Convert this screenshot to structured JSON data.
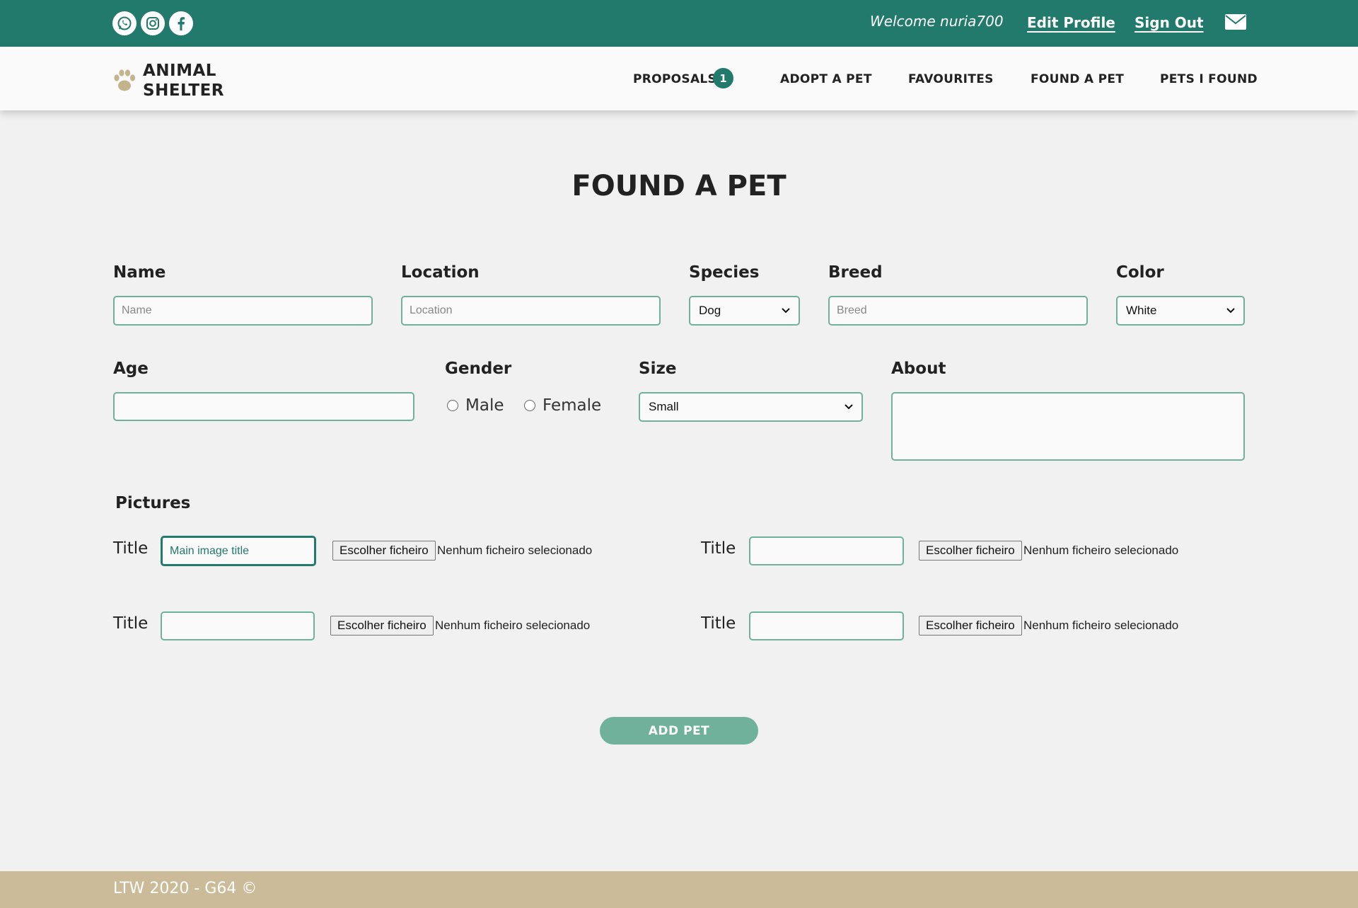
{
  "colors": {
    "primary": "#217a6b",
    "accent_light": "#6fb19a",
    "footer": "#cbbb98",
    "paw": "#c4b48e"
  },
  "topbar": {
    "social_icons": [
      "whatsapp-icon",
      "instagram-icon",
      "facebook-icon"
    ],
    "welcome": "Welcome nuria700",
    "edit_profile": "Edit Profile",
    "sign_out": "Sign Out",
    "mail_icon": "mail-icon"
  },
  "nav": {
    "logo_line1": "ANIMAL",
    "logo_line2": "SHELTER",
    "items": [
      "PROPOSALS",
      "ADOPT A PET",
      "FAVOURITES",
      "FOUND A PET",
      "PETS I FOUND"
    ],
    "proposals_badge": "1"
  },
  "page": {
    "title": "FOUND A PET"
  },
  "form": {
    "name": {
      "label": "Name",
      "placeholder": "Name",
      "value": ""
    },
    "location": {
      "label": "Location",
      "placeholder": "Location",
      "value": ""
    },
    "species": {
      "label": "Species",
      "selected": "Dog"
    },
    "breed": {
      "label": "Breed",
      "placeholder": "Breed",
      "value": ""
    },
    "color": {
      "label": "Color",
      "selected": "White"
    },
    "age": {
      "label": "Age",
      "value": ""
    },
    "gender": {
      "label": "Gender",
      "options": [
        "Male",
        "Female"
      ],
      "selected": null
    },
    "size": {
      "label": "Size",
      "selected": "Small"
    },
    "about": {
      "label": "About",
      "value": ""
    },
    "pictures": {
      "label": "Pictures",
      "rows": [
        {
          "title_label": "Title",
          "title_value": "Main image title",
          "file_button": "Escolher ficheiro",
          "file_status": "Nenhum ficheiro selecionado"
        },
        {
          "title_label": "Title",
          "title_value": "",
          "file_button": "Escolher ficheiro",
          "file_status": "Nenhum ficheiro selecionado"
        },
        {
          "title_label": "Title",
          "title_value": "",
          "file_button": "Escolher ficheiro",
          "file_status": "Nenhum ficheiro selecionado"
        },
        {
          "title_label": "Title",
          "title_value": "",
          "file_button": "Escolher ficheiro",
          "file_status": "Nenhum ficheiro selecionado"
        }
      ]
    },
    "submit": "ADD PET"
  },
  "footer": {
    "text": "LTW 2020 - G64 ©"
  }
}
